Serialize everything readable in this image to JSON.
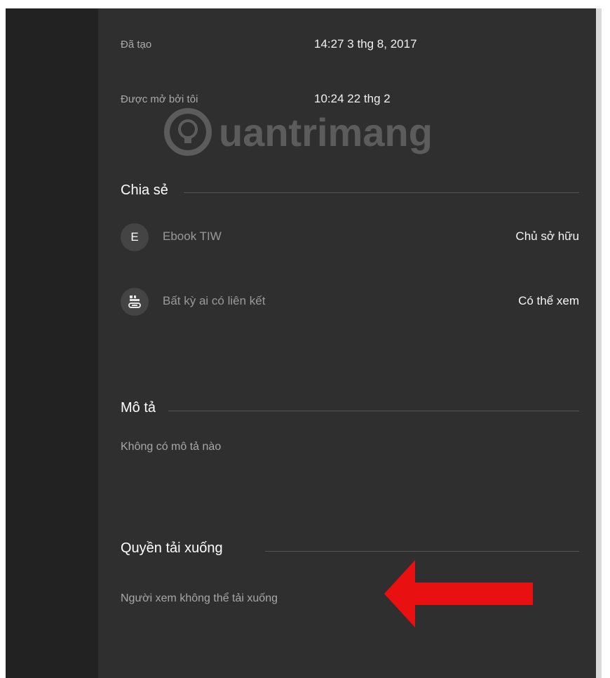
{
  "meta": {
    "created_label": "Đã tạo",
    "created_value": "14:27 3 thg 8, 2017",
    "opened_label": "Được mở bởi tôi",
    "opened_value": "10:24 22 thg 2"
  },
  "watermark": {
    "text": "uantrimang"
  },
  "sharing": {
    "title": "Chia sẻ",
    "items": [
      {
        "avatar": "E",
        "name": "Ebook TIW",
        "role": "Chủ sở hữu"
      },
      {
        "icon": "link-people-icon",
        "name": "Bất kỳ ai có liên kết",
        "role": "Có thể xem"
      }
    ]
  },
  "description": {
    "title": "Mô tả",
    "text": "Không có mô tả nào"
  },
  "download": {
    "title": "Quyền tải xuống",
    "text": "Người xem không thể tải xuống"
  },
  "colors": {
    "panel_bg": "#2f2f2f",
    "rail_bg": "#222222",
    "arrow": "#e81010"
  }
}
